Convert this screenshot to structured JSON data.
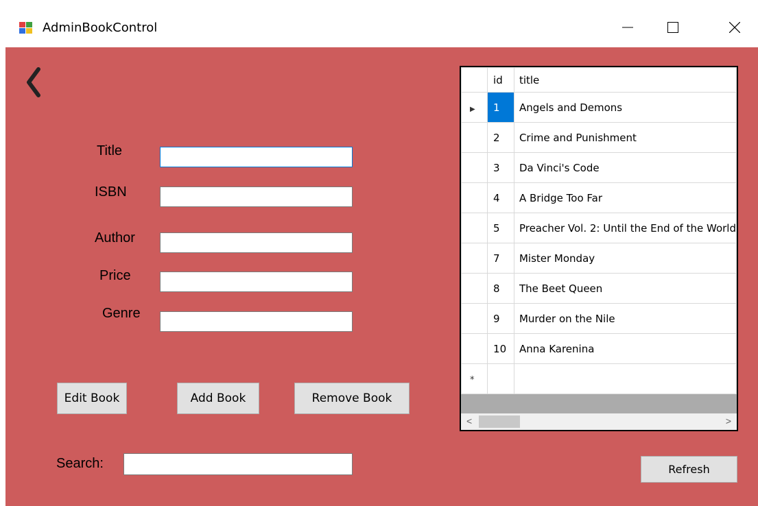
{
  "window": {
    "title": "AdminBookControl",
    "controls": {
      "minimize": "—",
      "maximize": "☐",
      "close": "✕"
    }
  },
  "form": {
    "back_icon": "chevron-left-icon",
    "fields": [
      {
        "label": "Title",
        "value": ""
      },
      {
        "label": "ISBN",
        "value": ""
      },
      {
        "label": "Author",
        "value": ""
      },
      {
        "label": "Price",
        "value": ""
      },
      {
        "label": "Genre",
        "value": ""
      }
    ],
    "buttons": {
      "edit": "Edit Book",
      "add": "Add Book",
      "remove": "Remove Book"
    },
    "search": {
      "label": "Search:",
      "value": ""
    },
    "refresh": "Refresh"
  },
  "grid": {
    "columns": [
      "id",
      "title"
    ],
    "rows": [
      {
        "id": "1",
        "title": "Angels and Demons"
      },
      {
        "id": "2",
        "title": "Crime and Punishment"
      },
      {
        "id": "3",
        "title": "Da Vinci's Code"
      },
      {
        "id": "4",
        "title": "A Bridge Too Far"
      },
      {
        "id": "5",
        "title": "Preacher Vol. 2: Until the End of the World"
      },
      {
        "id": "7",
        "title": "Mister Monday"
      },
      {
        "id": "8",
        "title": "The Beet Queen"
      },
      {
        "id": "9",
        "title": "Murder on the Nile"
      },
      {
        "id": "10",
        "title": "Anna Karenina"
      }
    ],
    "current_row_marker": "▶",
    "new_row_marker": "*",
    "scroll_left": "<",
    "scroll_right": ">"
  },
  "colors": {
    "background": "#cd5c5c",
    "selection": "#0078d7"
  }
}
